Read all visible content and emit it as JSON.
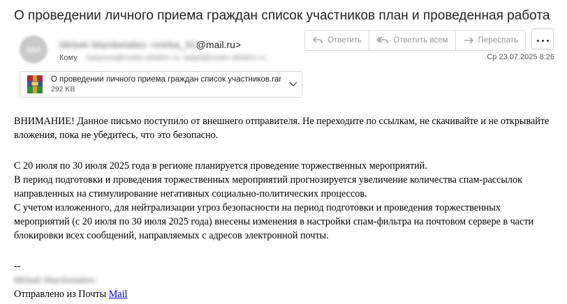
{
  "email": {
    "subject": "О проведении личного приема граждан список участников план и проведенная работа",
    "avatar_initials": "МИ",
    "from_name_redacted": "Mirbek Mambetaliev <mirba_50",
    "from_domain": "@mail.ru>",
    "to_label": "Кому",
    "to_redacted": "tadyrova@mobo-oblakm.ru; tadyb@mobo-oblakm.ru",
    "date": "Ср 23.07.2025 8:26"
  },
  "actions": {
    "reply": "Ответить",
    "reply_all": "Ответить всем",
    "forward": "Переслать",
    "more_icon": "more-dots-icon"
  },
  "attachment": {
    "name": "О проведении личного приема граждан список участников.rar",
    "size": "292 KB",
    "icon": "winrar-archive-icon"
  },
  "body": {
    "warning": "ВНИМАНИЕ! Данное письмо поступило от внешнего отправителя. Не переходите по ссылкам, не скачивайте и не открывайте вложения, пока не убедитесь, что это безопасно.",
    "para1": "С 20 июля по 30 июля 2025 года в регионе планируется проведение торжественных мероприятий.",
    "para2": "В период подготовки и проведения торжественных мероприятий прогнозируется увеличение количества спам-рассылок направленных на стимулирование негативных социально-политических процессов.",
    "para3": "С учетом изложенного, для нейтрализации угроз безопасности на период подготовки и проведения торжественных мероприятий (с 20 июля по 30 июля 2025 года) внесены изменения в настройки спам-фильтра на почтовом сервере в части блокировки всех сообщений, направляемых с адресов электронной почты.",
    "sig_dash": "--",
    "sig_name_redacted": "Mirbek Mambetaliev",
    "sent_from": "Отправлено из Почты",
    "sent_from_link": "Mail"
  },
  "colors": {
    "link": "#0000ee",
    "border": "#dcdcdc",
    "muted": "#9a9a9a"
  }
}
